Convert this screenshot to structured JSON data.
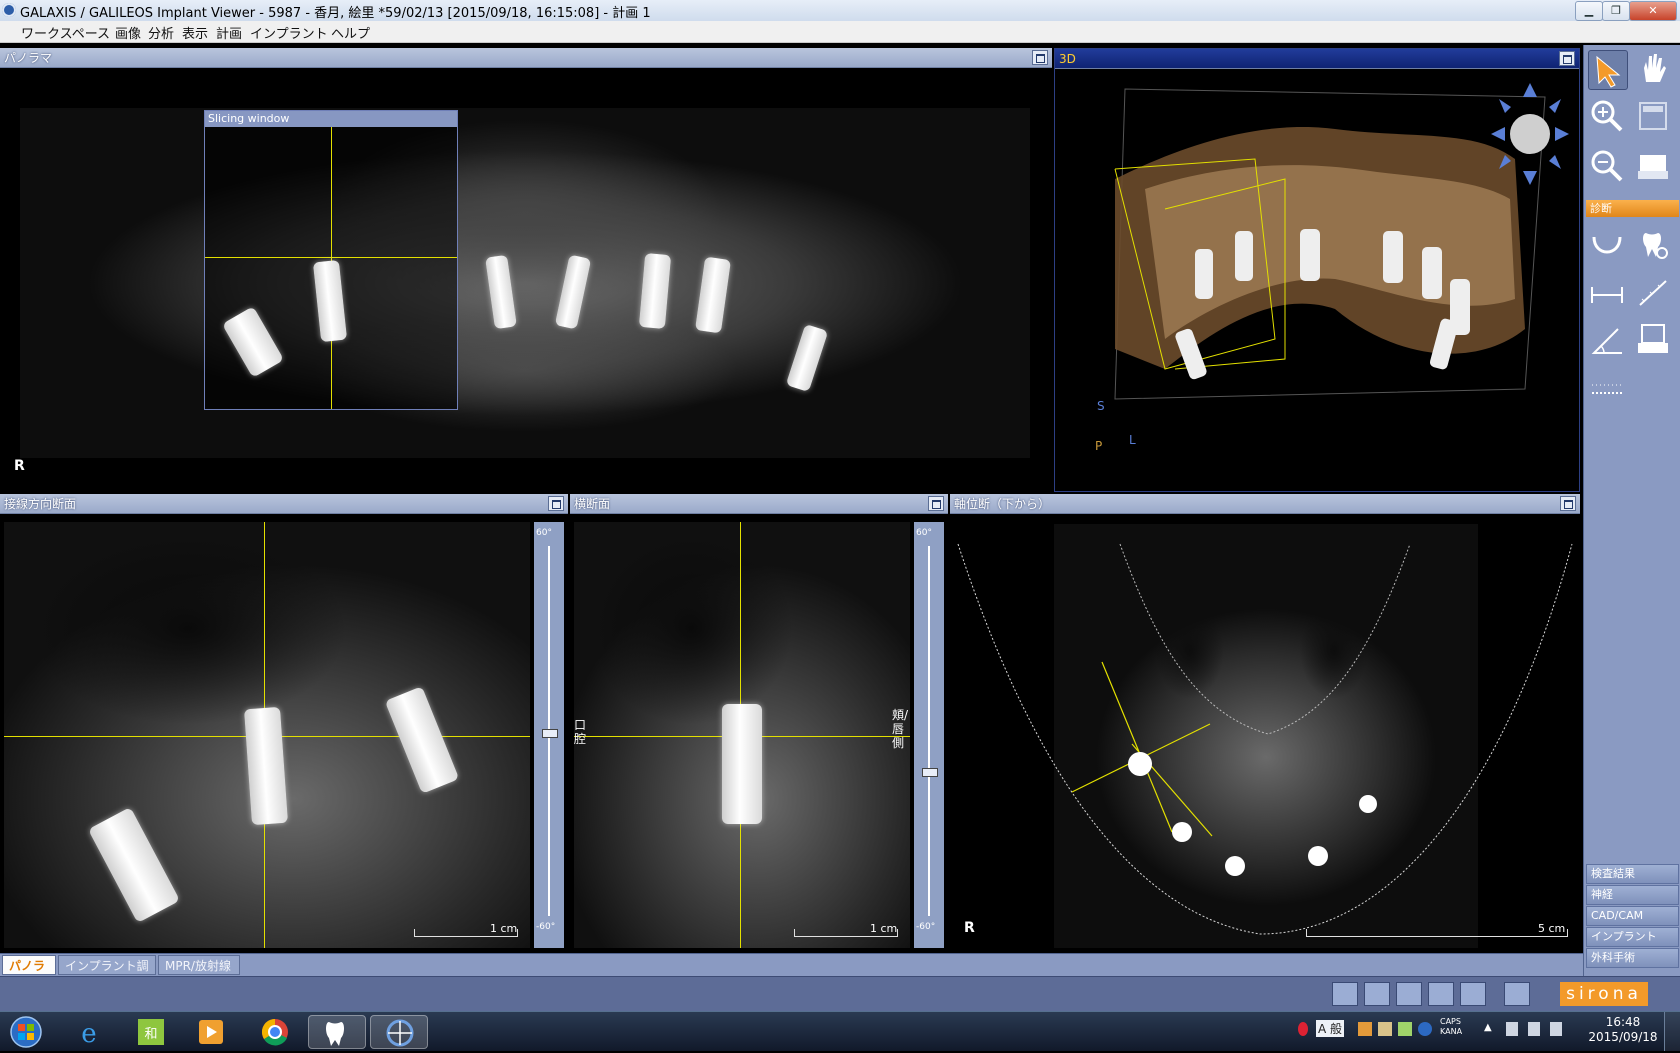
{
  "window": {
    "title": "GALAXIS / GALILEOS Implant Viewer - 5987 - 香月, 絵里 *59/02/13 [2015/09/18, 16:15:08] - 計画 1"
  },
  "menu": [
    "ワークスペース",
    "画像",
    "分析",
    "表示",
    "計画",
    "インプラント",
    "ヘルプ"
  ],
  "panels": {
    "panorama": {
      "title": "パノラマ",
      "orientation_label": "R",
      "slicing_window_title": "Slicing window"
    },
    "view3d": {
      "title": "3D",
      "axis_s": "S",
      "axis_p": "P",
      "axis_l": "L"
    },
    "tangential": {
      "title": "接線方向断面",
      "scale_label": "1 cm",
      "slider_top": "60°",
      "slider_bottom": "-60°"
    },
    "cross": {
      "title": "横断面",
      "scale_label": "1 cm",
      "slider_top": "60°",
      "slider_bottom": "-60°",
      "left_label": "口腔",
      "right_label": "頬/唇側"
    },
    "axial": {
      "title": "軸位断（下から）",
      "orientation_label": "R",
      "scale_label": "5 cm"
    }
  },
  "toolbar": {
    "sections": {
      "diagnosis": "診断"
    },
    "tools": [
      "select-arrow",
      "pan-hand",
      "zoom-in",
      "window-level",
      "zoom-out",
      "print-area",
      "panoramic-curve",
      "tooth-settings",
      "distance-measure",
      "path-measure",
      "angle-measure",
      "report",
      "density-measure"
    ],
    "bottom_items": [
      "検査結果",
      "神経",
      "CAD/CAM",
      "インプラント",
      "外科手術"
    ]
  },
  "tabs": [
    "パノラマ",
    "インプラント調整",
    "MPR/放射線"
  ],
  "active_tab": 0,
  "status": {
    "brand": "sirona"
  },
  "taskbar": {
    "apps": [
      "start",
      "internet-explorer",
      "ime-tool",
      "media-player",
      "chrome",
      "sidexis",
      "galaxis"
    ],
    "tray": {
      "ime": "A 般",
      "caps": "CAPS",
      "kana": "KANA",
      "time": "16:48",
      "date": "2015/09/18"
    }
  },
  "colors": {
    "toolbar_bg": "#8a9ac2",
    "accent_orange": "#f39a2a",
    "crosshair": "#e3e000"
  }
}
